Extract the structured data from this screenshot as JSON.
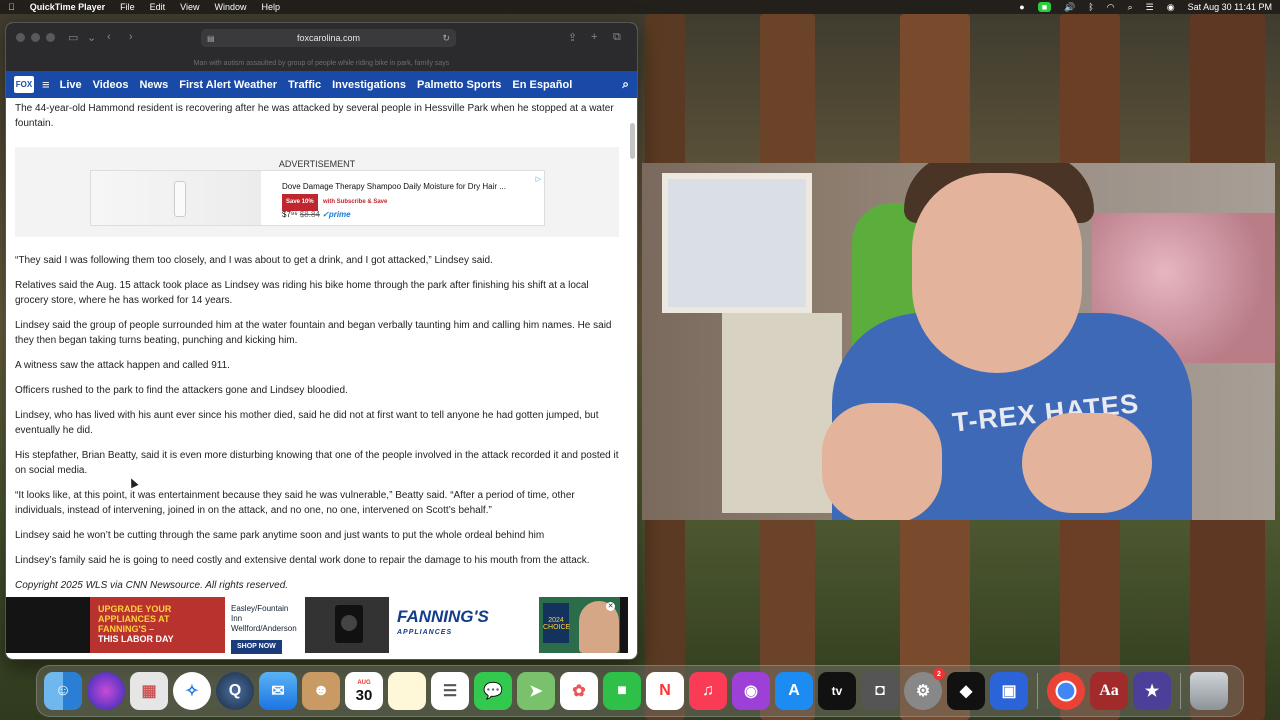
{
  "menubar": {
    "app_name": "QuickTime Player",
    "menus": [
      "File",
      "Edit",
      "View",
      "Window",
      "Help"
    ],
    "datetime": "Sat Aug 30  11:41 PM"
  },
  "browser": {
    "url": "foxcarolina.com",
    "tab_title": "Man with autism assaulted by group of people while riding bike in park, family says"
  },
  "site_nav": {
    "logo": "FOX",
    "items": [
      "Live",
      "Videos",
      "News",
      "First Alert Weather",
      "Traffic",
      "Investigations",
      "Palmetto Sports",
      "En Español"
    ]
  },
  "article": {
    "intro": "The 44-year-old Hammond resident is recovering after he was attacked by several people in Hessville Park when he stopped at a water fountain.",
    "ad_label": "ADVERTISEMENT",
    "ad": {
      "title": "Dove Damage Therapy Shampoo Daily Moisture for Dry Hair ...",
      "save": "Save 10%",
      "subscribe": "with Subscribe & Save",
      "price": "$7⁹⁶",
      "old_price": "$8.84",
      "prime": "✓prime"
    },
    "paragraphs": [
      "“They said I was following them too closely, and I was about to get a drink, and I got attacked,” Lindsey said.",
      "Relatives said the Aug. 15 attack took place as Lindsey was riding his bike home through the park after finishing his shift at a local grocery store, where he has worked for 14 years.",
      "Lindsey said the group of people surrounded him at the water fountain and began verbally taunting him and calling him names. He said they then began taking turns beating, punching and kicking him.",
      "A witness saw the attack happen and called 911.",
      "Officers rushed to the park to find the attackers gone and Lindsey bloodied.",
      "Lindsey, who has lived with his aunt ever since his mother died, said he did not at first want to tell anyone he had gotten jumped, but eventually he did.",
      "His stepfather, Brian Beatty, said it is even more disturbing knowing that one of the people involved in the attack recorded it and posted it on social media.",
      "“It looks like, at this point, it was entertainment because they said he was vulnerable,” Beatty said. “After a period of time, other individuals, instead of intervening, joined in on the attack, and no one, no one, intervened on Scott’s behalf.”",
      "Lindsey said he won’t be cutting through the same park anytime soon and just wants to put the whole ordeal behind him",
      "Lindsey’s family said he is going to need costly and extensive dental work done to repair the damage to his mouth from the attack."
    ],
    "copyright": "Copyright 2025 WLS via CNN Newsource. All rights reserved."
  },
  "banner_ad": {
    "headline": "UPGRADE YOUR APPLIANCES AT FANNING'S –",
    "headline2": "THIS LABOR DAY",
    "locations": "Easley/Fountain Inn Wellford/Anderson",
    "cta": "SHOP NOW",
    "brand": "FANNING'S",
    "brand_sub": "APPLIANCES",
    "award": "2024 CHOICE"
  },
  "webcam": {
    "shirt_text": "T-REX HATES"
  },
  "dock": {
    "calendar_month": "AUG",
    "calendar_day": "30",
    "settings_badge": "2",
    "apps": [
      "finder-icon",
      "siri-icon",
      "launchpad-icon",
      "safari-icon",
      "quicktime-icon",
      "mail-icon",
      "contacts-icon",
      "calendar-icon",
      "notes-icon",
      "reminders-icon",
      "messages-icon",
      "maps-icon",
      "photos-icon",
      "facetime-icon",
      "news-icon",
      "music-icon",
      "podcasts-icon",
      "appstore-icon",
      "tv-icon",
      "screenshot-icon",
      "settings-icon",
      "roblox-studio-icon",
      "roblox-icon",
      "chrome-icon",
      "dictionary-icon",
      "imovie-icon",
      "trash-icon"
    ],
    "tv_label": "tv",
    "dict_label": "Aa"
  }
}
